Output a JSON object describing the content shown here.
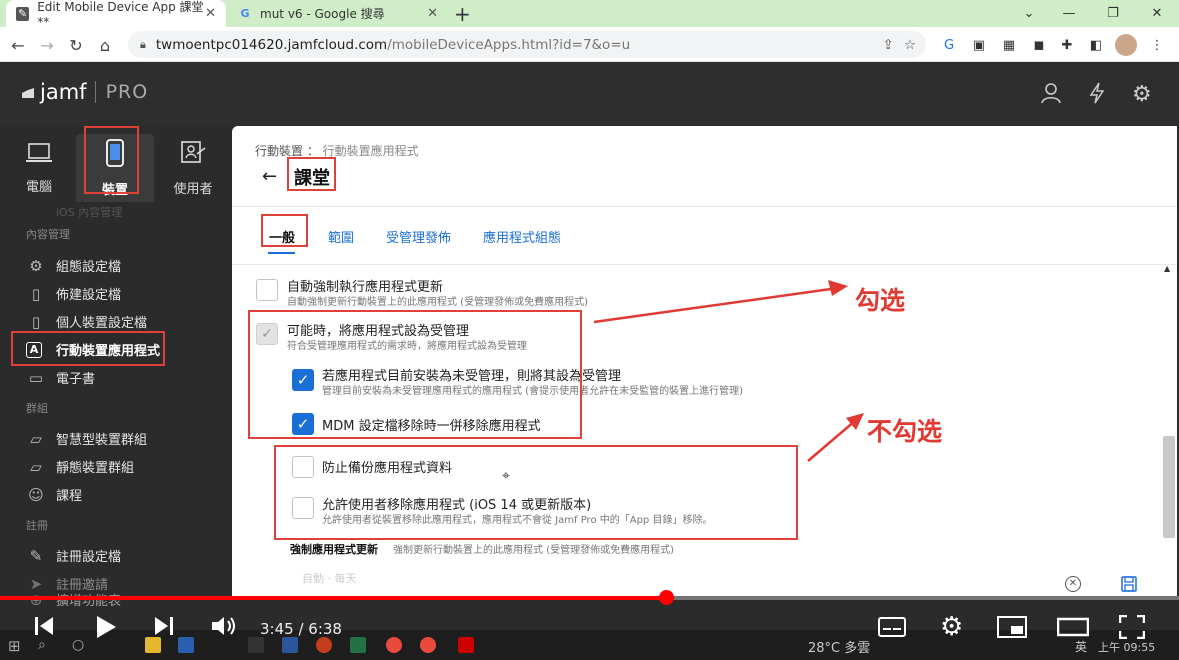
{
  "browser": {
    "tabs": [
      {
        "title": "Edit Mobile Device App 課堂**"
      },
      {
        "title": "mut v6 - Google 搜尋"
      }
    ],
    "new_tab": "+",
    "url_host": "twmoentpc014620.jamfcloud.com",
    "url_path": "/mobileDeviceApps.html?id=7&o=u"
  },
  "jamf": {
    "logo": "jamf",
    "logo_suffix": "PRO"
  },
  "sidebar": {
    "nav": [
      {
        "label": "電腦"
      },
      {
        "label": "裝置"
      },
      {
        "label": "使用者"
      }
    ],
    "faded_item": "iOS 內容管理",
    "sections": {
      "content": "內容管理",
      "groups": "群組",
      "enroll": "註冊"
    },
    "items": [
      {
        "label": "組態設定檔"
      },
      {
        "label": "佈建設定檔"
      },
      {
        "label": "個人裝置設定檔"
      },
      {
        "label": "行動裝置應用程式"
      },
      {
        "label": "電子書"
      },
      {
        "label": "智慧型裝置群組"
      },
      {
        "label": "靜態裝置群組"
      },
      {
        "label": "課程"
      },
      {
        "label": "註冊設定檔"
      },
      {
        "label": "註冊邀請"
      },
      {
        "label": "擴增功能表"
      }
    ]
  },
  "main": {
    "breadcrumb_parent": "行動裝置 ：",
    "breadcrumb_child": "行動裝置應用程式",
    "title": "課堂",
    "tabs": [
      {
        "label": "一般"
      },
      {
        "label": "範圍"
      },
      {
        "label": "受管理發佈"
      },
      {
        "label": "應用程式組態"
      }
    ],
    "options": [
      {
        "label": "自動強制執行應用程式更新",
        "desc": "自動強制更新行動裝置上的此應用程式 (受管理發佈或免費應用程式)"
      },
      {
        "label": "可能時，將應用程式設為受管理",
        "desc": "符合受管理應用程式的需求時，將應用程式設為受管理"
      },
      {
        "label": "若應用程式目前安裝為未受管理，則將其設為受管理",
        "desc": "管理目前安裝為未受管理應用程式的應用程式 (會提示使用者允許在未受監管的裝置上進行管理)"
      },
      {
        "label": "MDM 設定檔移除時一併移除應用程式",
        "desc": ""
      },
      {
        "label": "防止備份應用程式資料",
        "desc": ""
      },
      {
        "label": "允許使用者移除應用程式 (iOS 14 或更新版本)",
        "desc": "允許使用者從裝置移除此應用程式，應用程式不會從 Jamf Pro 中的「App 目錄」移除。"
      }
    ],
    "force_update_label": "強制應用程式更新",
    "force_update_desc": "強制更新行動裝置上的此應用程式 (受管理發佈或免費應用程式)",
    "faded_next": "自動 · 每天",
    "cancel": "取消",
    "save": "儲存"
  },
  "annotations": {
    "check": "勾选",
    "uncheck": "不勾选"
  },
  "video": {
    "time": "3:45 / 6:38",
    "progress": 0.565
  },
  "taskbar": {
    "weather": "28°C  多雲",
    "ime": "英",
    "clock": "上午 09:55"
  }
}
